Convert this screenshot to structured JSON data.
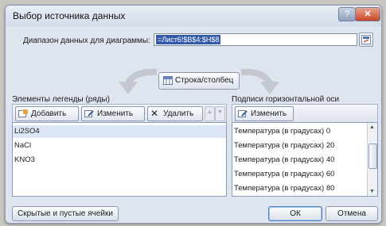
{
  "dialog": {
    "title": "Выбор источника данных",
    "range_label": "Диапазон данных для диаграммы:",
    "range_value": "=Лист6!$B$4:$H$8",
    "switch_label": "Строка/столбец"
  },
  "legend": {
    "label": "Элементы легенды (ряды)",
    "add_label": "Добавить",
    "edit_label": "Изменить",
    "delete_label": "Удалить",
    "items": [
      "Li2SO4",
      "NaCl",
      "KNO3"
    ]
  },
  "axis": {
    "label": "Подписи горизонтальной оси (категории)",
    "edit_label": "Изменить",
    "items": [
      "Температура (в градусах) 0",
      "Температура (в градусах) 20",
      "Температура (в градусах) 40",
      "Температура (в градусах) 60",
      "Температура (в градусах) 80"
    ]
  },
  "footer": {
    "hidden_cells_label": "Скрытые и пустые ячейки",
    "ok_label": "ОК",
    "cancel_label": "Отмена"
  },
  "colors": {
    "selection": "#335aa8",
    "close_button": "#c8452a"
  }
}
